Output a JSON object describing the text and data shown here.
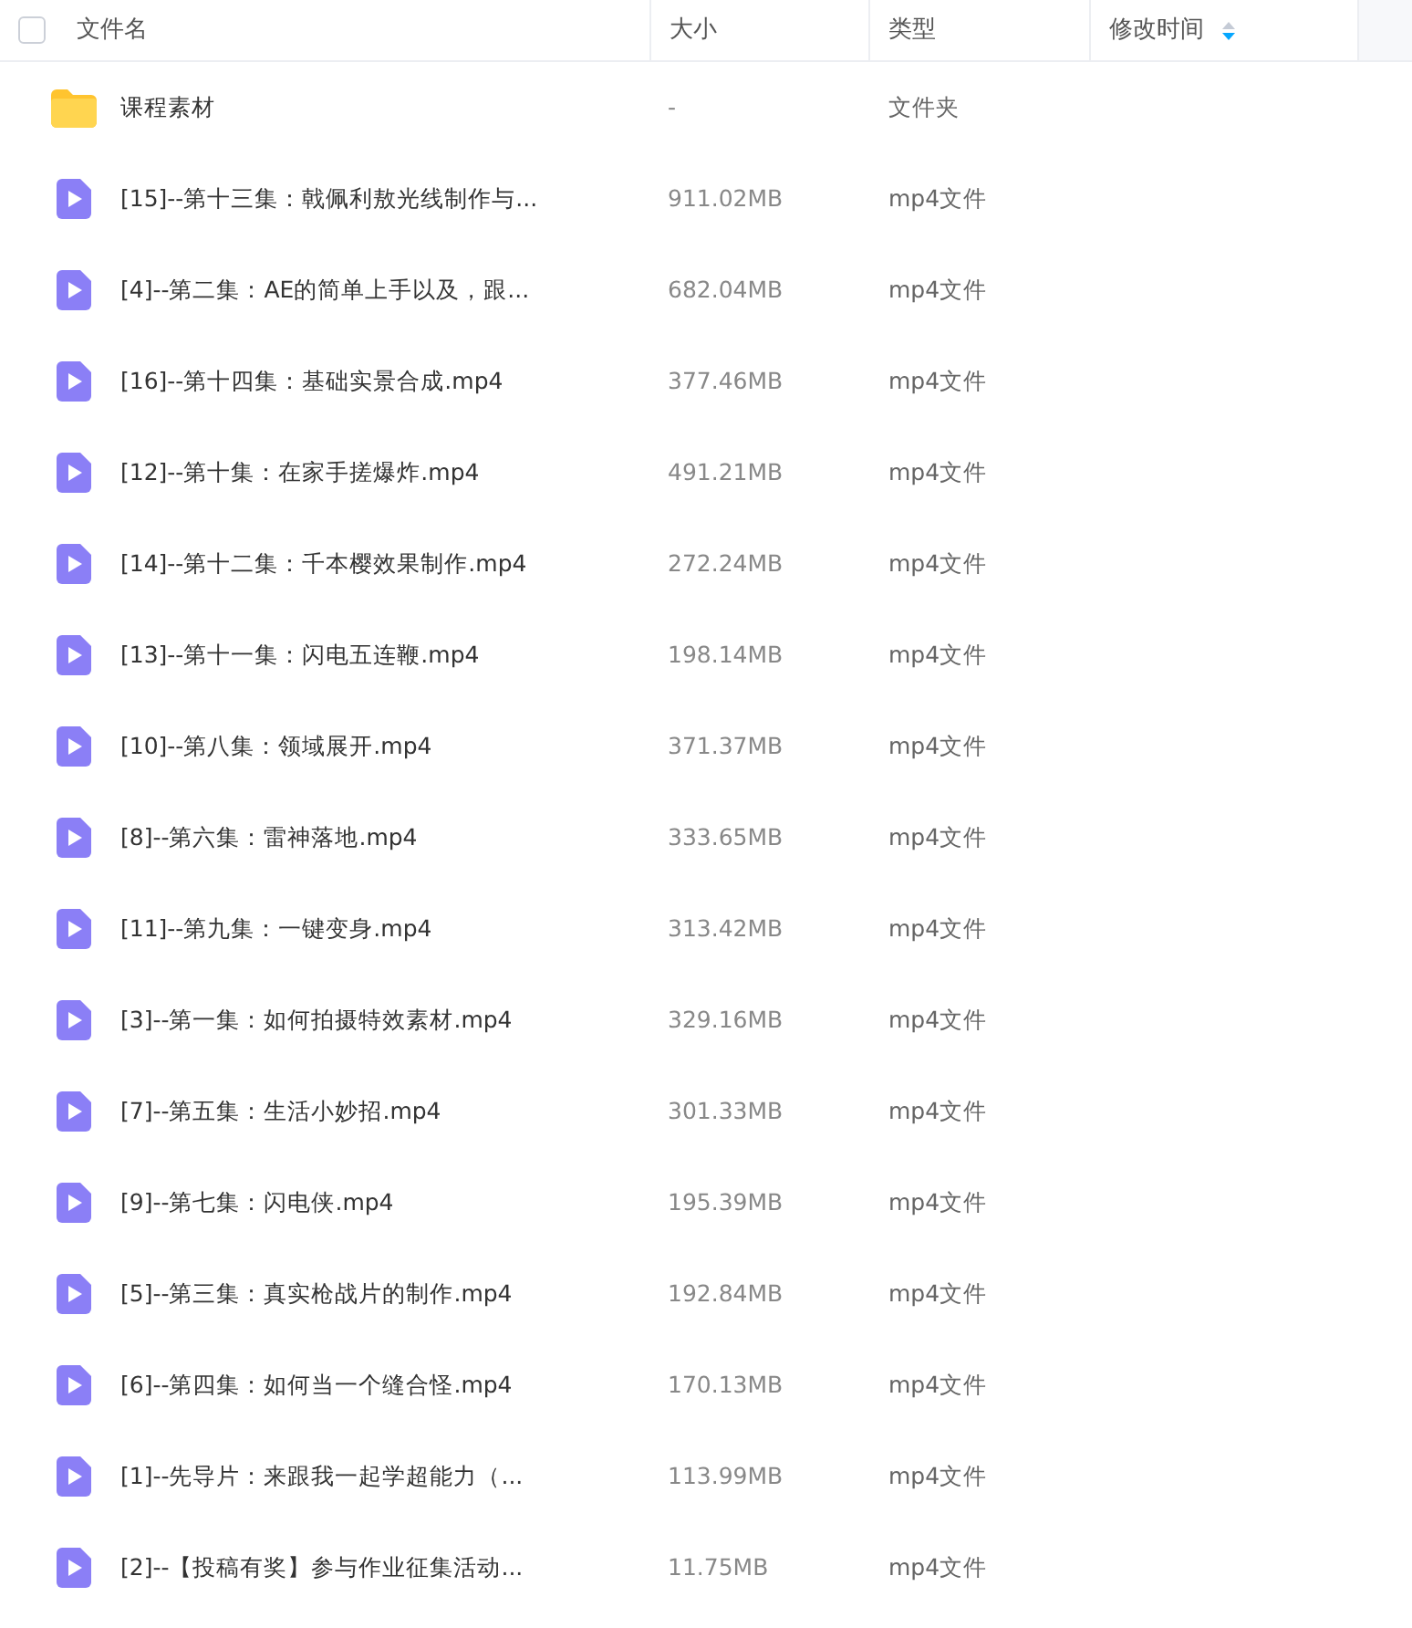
{
  "header": {
    "select_all": {
      "checked": false
    },
    "columns": [
      {
        "label": "文件名"
      },
      {
        "label": "大小"
      },
      {
        "label": "类型"
      },
      {
        "label": "修改时间",
        "sorted": true
      }
    ]
  },
  "files": [
    {
      "kind": "folder",
      "name": "课程素材",
      "size": "-",
      "type": "文件夹"
    },
    {
      "kind": "video",
      "name": "[15]--第十三集：戟佩利敖光线制作与...",
      "size": "911.02MB",
      "type": "mp4文件"
    },
    {
      "kind": "video",
      "name": "[4]--第二集：AE的简单上手以及，跟...",
      "size": "682.04MB",
      "type": "mp4文件"
    },
    {
      "kind": "video",
      "name": "[16]--第十四集：基础实景合成.mp4",
      "size": "377.46MB",
      "type": "mp4文件"
    },
    {
      "kind": "video",
      "name": "[12]--第十集：在家手搓爆炸.mp4",
      "size": "491.21MB",
      "type": "mp4文件"
    },
    {
      "kind": "video",
      "name": "[14]--第十二集：千本樱效果制作.mp4",
      "size": "272.24MB",
      "type": "mp4文件"
    },
    {
      "kind": "video",
      "name": "[13]--第十一集：闪电五连鞭.mp4",
      "size": "198.14MB",
      "type": "mp4文件"
    },
    {
      "kind": "video",
      "name": "[10]--第八集：领域展开.mp4",
      "size": "371.37MB",
      "type": "mp4文件"
    },
    {
      "kind": "video",
      "name": "[8]--第六集：雷神落地.mp4",
      "size": "333.65MB",
      "type": "mp4文件"
    },
    {
      "kind": "video",
      "name": "[11]--第九集：一键变身.mp4",
      "size": "313.42MB",
      "type": "mp4文件"
    },
    {
      "kind": "video",
      "name": "[3]--第一集：如何拍摄特效素材.mp4",
      "size": "329.16MB",
      "type": "mp4文件"
    },
    {
      "kind": "video",
      "name": "[7]--第五集：生活小妙招.mp4",
      "size": "301.33MB",
      "type": "mp4文件"
    },
    {
      "kind": "video",
      "name": "[9]--第七集：闪电侠.mp4",
      "size": "195.39MB",
      "type": "mp4文件"
    },
    {
      "kind": "video",
      "name": "[5]--第三集：真实枪战片的制作.mp4",
      "size": "192.84MB",
      "type": "mp4文件"
    },
    {
      "kind": "video",
      "name": "[6]--第四集：如何当一个缝合怪.mp4",
      "size": "170.13MB",
      "type": "mp4文件"
    },
    {
      "kind": "video",
      "name": "[1]--先导片：来跟我一起学超能力（...",
      "size": "113.99MB",
      "type": "mp4文件"
    },
    {
      "kind": "video",
      "name": "[2]--【投稿有奖】参与作业征集活动...",
      "size": "11.75MB",
      "type": "mp4文件"
    }
  ]
}
